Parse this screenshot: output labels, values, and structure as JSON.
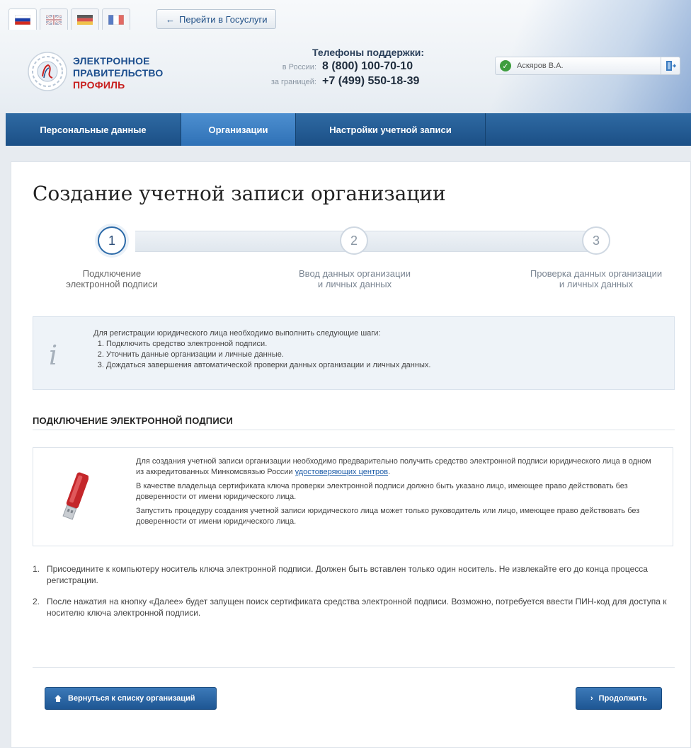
{
  "languages": [
    {
      "name": "russian-flag-icon",
      "active": true
    },
    {
      "name": "uk-flag-icon",
      "active": false
    },
    {
      "name": "german-flag-icon",
      "active": false
    },
    {
      "name": "french-flag-icon",
      "active": false
    }
  ],
  "header": {
    "goto_label": "Перейти в Госуслуги",
    "logo_line1": "ЭЛЕКТРОННОЕ",
    "logo_line2": "ПРАВИТЕЛЬСТВО",
    "logo_line3": "ПРОФИЛЬ",
    "phones_title": "Телефоны поддержки:",
    "phone_russia_label": "в России:",
    "phone_russia": "8 (800) 100-70-10",
    "phone_abroad_label": "за границей:",
    "phone_abroad": "+7 (499) 550-18-39",
    "user_name": "Аскяров В.А."
  },
  "nav": {
    "items": [
      {
        "label": "Персональные данные",
        "active": false
      },
      {
        "label": "Организации",
        "active": true
      },
      {
        "label": "Настройки учетной записи",
        "active": false
      }
    ]
  },
  "page": {
    "title": "Создание учетной записи организации",
    "steps": [
      {
        "number": "1",
        "line1": "Подключение",
        "line2": "электронной подписи",
        "active": true
      },
      {
        "number": "2",
        "line1": "Ввод данных организации",
        "line2": "и личных данных",
        "active": false
      },
      {
        "number": "3",
        "line1": "Проверка данных организации",
        "line2": "и личных данных",
        "active": false
      }
    ],
    "info": {
      "intro": "Для регистрации юридического лица необходимо выполнить следующие шаги:",
      "items": [
        "Подключить средство электронной подписи.",
        "Уточнить данные организации и личные данные.",
        "Дождаться завершения автоматической проверки данных организации и личных данных."
      ]
    },
    "section_title": "ПОДКЛЮЧЕНИЕ ЭЛЕКТРОННОЙ ПОДПИСИ",
    "signature": {
      "p1_text": "Для создания учетной записи организации необходимо предварительно получить средство электронной подписи юридического лица в одном из аккредитованных Минкомсвязью России ",
      "p1_link": "удостоверяющих центров",
      "p1_end": ".",
      "p2": "В качестве владельца сертификата ключа проверки электронной подписи должно быть указано лицо, имеющее право действовать без доверенности от имени юридического лица.",
      "p3": "Запустить процедуру создания учетной записи юридического лица может только руководитель или лицо, имеющее право действовать без доверенности от имени юридического лица."
    },
    "instructions": [
      {
        "num": "1.",
        "text": "Присоедините к компьютеру носитель ключа электронной подписи. Должен быть вставлен только один носитель. Не извлекайте его до конца процесса регистрации."
      },
      {
        "num": "2.",
        "text": "После нажатия на кнопку «Далее» будет запущен поиск сертификата средства электронной подписи. Возможно, потребуется ввести ПИН-код для доступа к носителю ключа электронной подписи."
      }
    ],
    "back_button": "Вернуться к списку организаций",
    "next_button": "Продолжить"
  },
  "colors": {
    "nav_bg": "#1b4f86",
    "nav_active": "#2f71b6",
    "button_bg": "#1e5693",
    "link": "#1d5ca8",
    "logo_blue": "#1d4f8e",
    "logo_red": "#c8201f"
  }
}
